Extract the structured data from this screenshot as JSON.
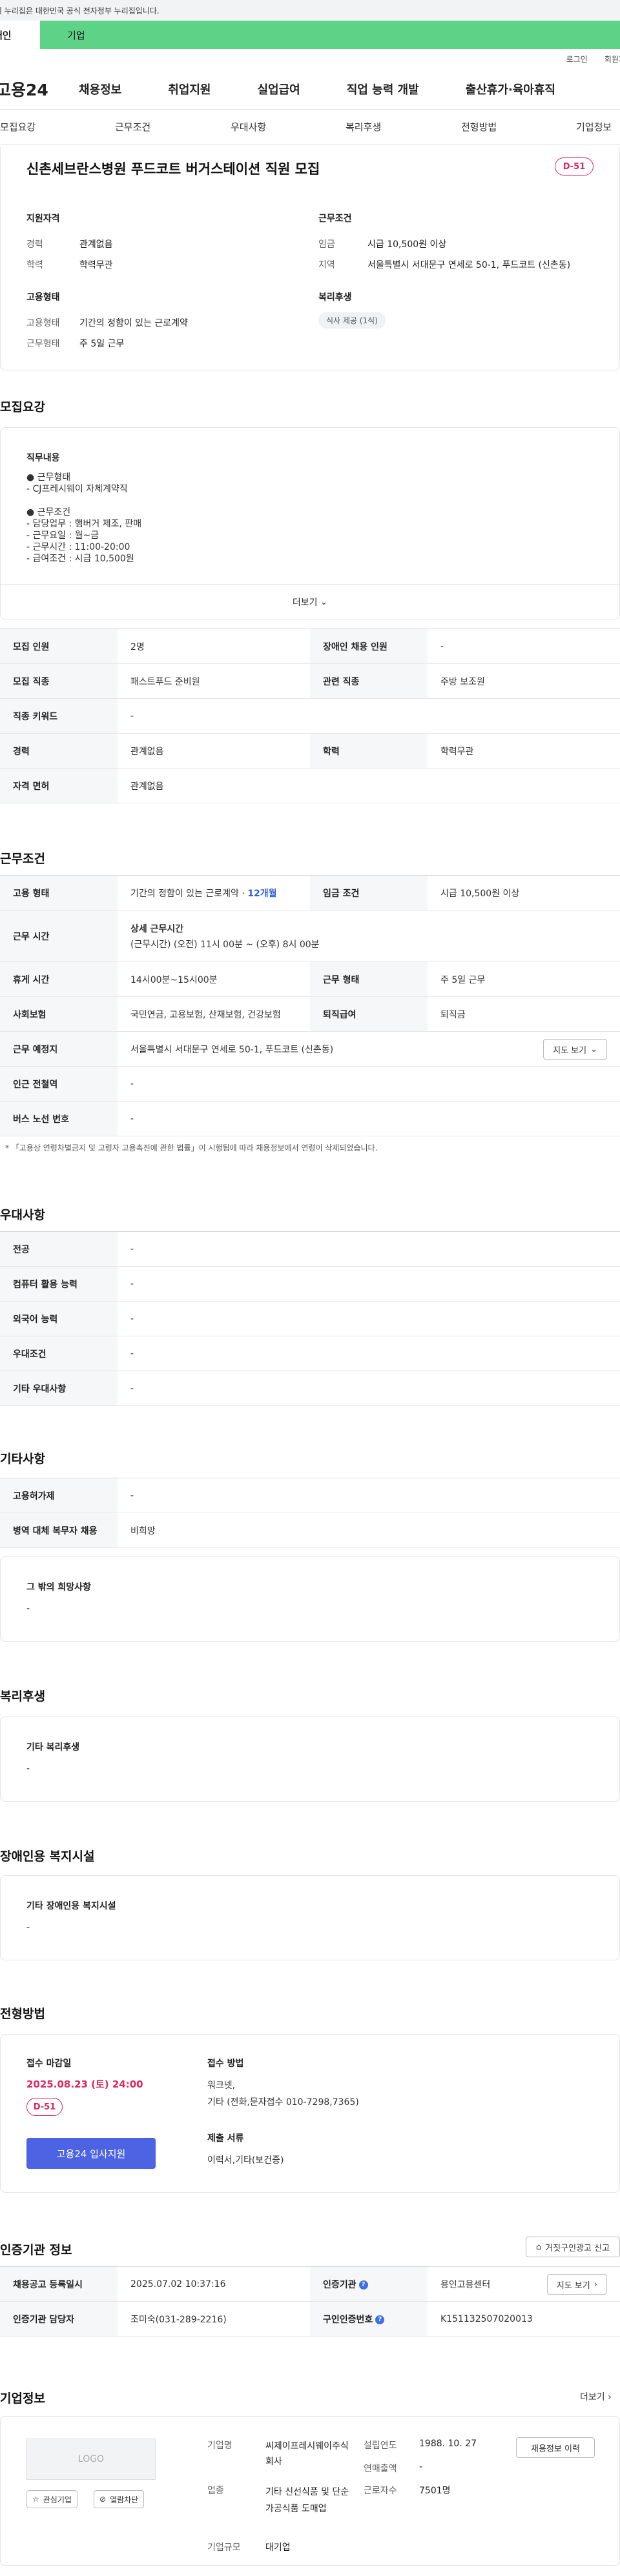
{
  "gov_banner": "이 누리집은 대한민국 공식 전자정부 누리집입니다.",
  "top_tabs": {
    "individual": "개인",
    "business": "기업"
  },
  "util": {
    "login": "로그인",
    "join": "회원가입"
  },
  "logo": "고용24",
  "gnb": [
    "채용정보",
    "취업지원",
    "실업급여",
    "직업 능력 개발",
    "출산휴가·육아휴직"
  ],
  "lnb": [
    "모집요강",
    "근무조건",
    "우대사항",
    "복리후생",
    "전형방법",
    "기업정보"
  ],
  "job": {
    "title": "신촌세브란스병원 푸드코트 버거스테이션 직원 모집",
    "dday": "D-51",
    "qual_title": "지원자격",
    "qual": [
      {
        "k": "경력",
        "v": "관계없음"
      },
      {
        "k": "학력",
        "v": "학력무관"
      }
    ],
    "cond_title": "근무조건",
    "cond": [
      {
        "k": "임금",
        "v": "시급 10,500원 이상"
      },
      {
        "k": "지역",
        "v": "서울특별시 서대문구 연세로 50-1, 푸드코트 (신촌동)"
      }
    ],
    "form_title": "고용형태",
    "form": [
      {
        "k": "고용형태",
        "v": "기간의 정함이 있는 근로계약"
      },
      {
        "k": "근무형태",
        "v": "주 5일 근무"
      }
    ],
    "welfare_title": "복리후생",
    "welfare_tag": "식사 제공 (1식)"
  },
  "recruit": {
    "title": "모집요강",
    "duty_label": "직무내용",
    "duty_lines": [
      "● 근무형태",
      "- CJ프레시웨이 자체계약직",
      "",
      "● 근무조건",
      "- 담당업무 : 햄버거 제조, 판매",
      "- 근무요일 : 월~금",
      "- 근무시간 : 11:00-20:00",
      "- 급여조건 : 시급 10,500원"
    ],
    "more": "더보기",
    "rows": [
      [
        "모집 인원",
        "2명",
        "장애인 채용 인원",
        "-"
      ],
      [
        "모집 직종",
        "패스트푸드 준비원",
        "관련 직종",
        "주방 보조원"
      ],
      [
        "직종 키워드",
        "-"
      ],
      [
        "경력",
        "관계없음",
        "학력",
        "학력무관"
      ],
      [
        "자격 면허",
        "관계없음"
      ]
    ]
  },
  "work": {
    "title": "근무조건",
    "emp_type_h": "고용 형태",
    "emp_type_v": "기간의 정함이 있는 근로계약 · ",
    "emp_type_link": "12개월",
    "wage_h": "임금 조건",
    "wage_v": "시급 10,500원 이상",
    "hours_h": "근무 시간",
    "hours_title": "상세 근무시간",
    "hours_v": "(근무시간) (오전) 11시 00분 ~ (오후) 8시 00분",
    "break_h": "휴게 시간",
    "break_v": "14시00분~15시00분",
    "shift_h": "근무 형태",
    "shift_v": "주 5일 근무",
    "ins_h": "사회보험",
    "ins_v": "국민연금, 고용보험, 산재보험, 건강보험",
    "sev_h": "퇴직급여",
    "sev_v": "퇴직금",
    "place_h": "근무 예정지",
    "place_v": "서울특별시 서대문구 연세로 50-1, 푸드코트 (신촌동)",
    "map_btn": "지도 보기",
    "subway_h": "인근 전철역",
    "subway_v": "-",
    "bus_h": "버스 노선 번호",
    "bus_v": "-",
    "note": "「고용상 연령차별금지 및 고령자 고용촉진에 관한 법률」이 시행됨에 따라 채용정보에서 연령이 삭제되었습니다."
  },
  "pref": {
    "title": "우대사항",
    "rows": [
      [
        "전공",
        "-"
      ],
      [
        "컴퓨터 활용 능력",
        "-"
      ],
      [
        "외국어 능력",
        "-"
      ],
      [
        "우대조건",
        "-"
      ],
      [
        "기타 우대사항",
        "-"
      ]
    ]
  },
  "etc": {
    "title": "기타사항",
    "rows": [
      [
        "고용허가제",
        "-"
      ],
      [
        "병역 대체 복무자 채용",
        "비희망"
      ]
    ],
    "hope_label": "그 밖의 희망사항",
    "hope_v": "-"
  },
  "benefit": {
    "title": "복리후생",
    "label": "기타 복리후생",
    "v": "-"
  },
  "disab": {
    "title": "장애인용 복지시설",
    "label": "기타 장애인용 복지시설",
    "v": "-"
  },
  "process": {
    "title": "전형방법",
    "deadline_label": "접수 마감일",
    "deadline": "2025.08.23 (토) 24:00",
    "dday": "D-51",
    "apply_btn": "고용24 입사지원",
    "method_label": "접수 방법",
    "method_v1": "워크넷,",
    "method_v2": "기타 (전화,문자접수 010-7298,7365)",
    "docs_label": "제출 서류",
    "docs_v": "이력서,기타(보건증)"
  },
  "cert": {
    "title": "인증기관 정보",
    "report_btn": "거짓구인광고 신고",
    "reg_h": "채용공고 등록일시",
    "reg_v": "2025.07.02 10:37:16",
    "org_h": "인증기관",
    "org_v": "용인고용센터",
    "map_btn": "지도 보기",
    "staff_h": "인증기관 담당자",
    "staff_v": "조미숙(031-289-2216)",
    "no_h": "구인인증번호",
    "no_v": "K151132507020013"
  },
  "company": {
    "title": "기업정보",
    "more": "더보기",
    "logo": "LOGO",
    "fav_btn": "관심기업",
    "block_btn": "열람차단",
    "name_k": "기업명",
    "name_v": "씨제이프레시웨이주식회사",
    "ind_k": "업종",
    "ind_v": "기타 신선식품 및 단순 가공식품 도매업",
    "size_k": "기업규모",
    "size_v": "대기업",
    "est_k": "설립연도",
    "est_v": "1988. 10. 27",
    "sales_k": "연매출액",
    "sales_v": "-",
    "emp_k": "근로자수",
    "emp_v": "7501명",
    "history_btn": "채용정보 이력"
  }
}
